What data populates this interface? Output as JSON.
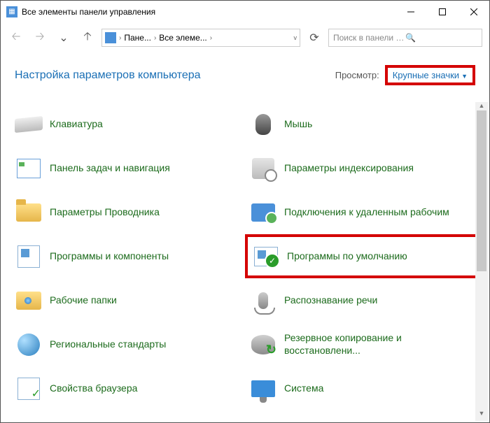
{
  "window": {
    "title": "Все элементы панели управления"
  },
  "breadcrumb": {
    "root_icon": "control-panel-icon",
    "segments": [
      "Пане...",
      "Все элеме..."
    ]
  },
  "search": {
    "placeholder": "Поиск в панели управле..."
  },
  "heading": "Настройка параметров компьютера",
  "view": {
    "label": "Просмотр:",
    "selected": "Крупные значки"
  },
  "items": [
    {
      "icon": "keyboard-icon",
      "label": "Клавиатура"
    },
    {
      "icon": "mouse-icon",
      "label": "Мышь"
    },
    {
      "icon": "taskbar-icon",
      "label": "Панель задач и навигация"
    },
    {
      "icon": "indexing-icon",
      "label": "Параметры индексирования"
    },
    {
      "icon": "explorer-options-icon",
      "label": "Параметры Проводника"
    },
    {
      "icon": "remote-desktop-icon",
      "label": "Подключения к удаленным рабочим"
    },
    {
      "icon": "programs-features-icon",
      "label": "Программы и компоненты"
    },
    {
      "icon": "default-programs-icon",
      "label": "Программы по умолчанию",
      "highlight": true
    },
    {
      "icon": "work-folders-icon",
      "label": "Рабочие папки"
    },
    {
      "icon": "speech-icon",
      "label": "Распознавание речи"
    },
    {
      "icon": "region-icon",
      "label": "Региональные стандарты"
    },
    {
      "icon": "backup-restore-icon",
      "label": "Резервное копирование и восстановлени..."
    },
    {
      "icon": "browser-properties-icon",
      "label": "Свойства браузера"
    },
    {
      "icon": "system-icon",
      "label": "Система"
    }
  ]
}
